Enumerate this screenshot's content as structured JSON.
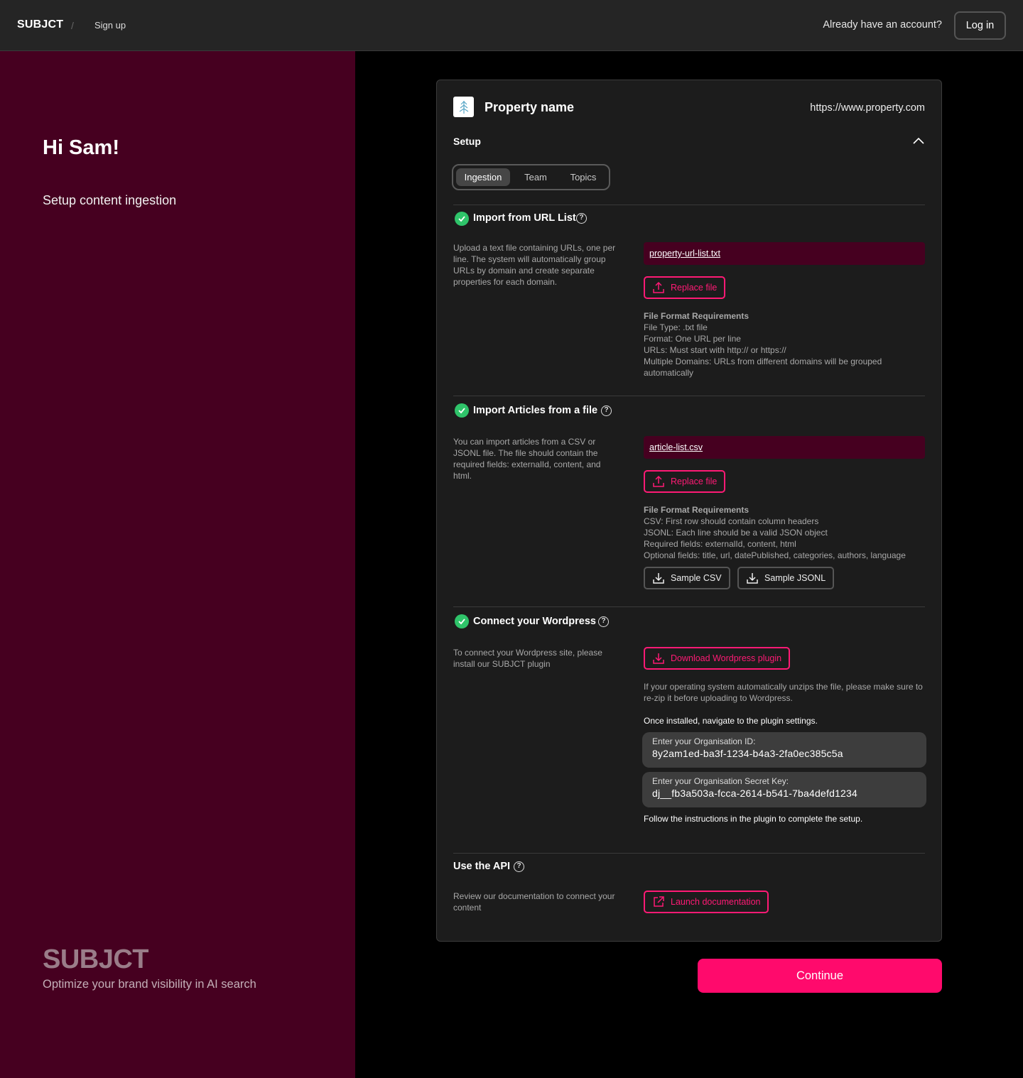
{
  "header": {
    "brand": "SUBJCT",
    "separator": "/",
    "breadcrumb": "Sign up",
    "already_account": "Already have an account?",
    "login_label": "Log in"
  },
  "left_panel": {
    "greeting": "Hi Sam!",
    "subtitle": "Setup content ingestion",
    "brand": "SUBJCT",
    "tagline": "Optimize your brand visibility in AI search"
  },
  "card": {
    "property_name": "Property name",
    "property_url": "https://www.property.com",
    "setup_title": "Setup",
    "tabs": [
      {
        "label": "Ingestion",
        "active": true
      },
      {
        "label": "Team",
        "active": false
      },
      {
        "label": "Topics",
        "active": false
      }
    ]
  },
  "url_list": {
    "title": "Import from URL List",
    "description": "Upload a text file containing URLs, one per line. The system will automatically group URLs by domain and create separate properties for each domain.",
    "file_name": "property-url-list.txt",
    "replace_label": "Replace file",
    "req_title": "File Format Requirements",
    "requirements": [
      "File Type: .txt file",
      "Format: One URL per line",
      "URLs: Must start with http:// or https://",
      "Multiple Domains: URLs from different domains will be grouped automatically"
    ]
  },
  "articles": {
    "title": "Import Articles from a file",
    "description": "You can import articles from a CSV or JSONL file. The file should contain the required fields: externalId, content, and html.",
    "file_name": "article-list.csv",
    "replace_label": "Replace file",
    "req_title": "File Format Requirements",
    "requirements": [
      "CSV: First row should contain column headers",
      "JSONL: Each line should be a valid JSON object",
      "Required fields: externalId, content, html",
      "Optional fields: title, url, datePublished, categories, authors, language"
    ],
    "sample_csv": "Sample CSV",
    "sample_jsonl": "Sample JSONL"
  },
  "wordpress": {
    "title": "Connect your Wordpress",
    "description": "To connect your Wordpress site, please install our SUBJCT plugin",
    "download_label": "Download Wordpress plugin",
    "unzip_note": "If your operating system automatically unzips the file, please make sure to re-zip it before uploading to Wordpress.",
    "navigate_note": "Once installed, navigate to the plugin settings.",
    "org_id_label": "Enter your Organisation ID:",
    "org_id_value": "8y2am1ed-ba3f-1234-b4a3-2fa0ec385c5a",
    "secret_label": "Enter your Organisation Secret Key:",
    "secret_value": "dj__fb3a503a-fcca-2614-b541-7ba4defd1234",
    "follow_note": "Follow the instructions in the plugin to complete the setup."
  },
  "api": {
    "title": "Use the API",
    "description": "Review our documentation to connect your content",
    "launch_label": "Launch documentation"
  },
  "continue_label": "Continue",
  "colors": {
    "accent": "#ff0a6c",
    "panel": "#460020",
    "success": "#2fc46a"
  }
}
